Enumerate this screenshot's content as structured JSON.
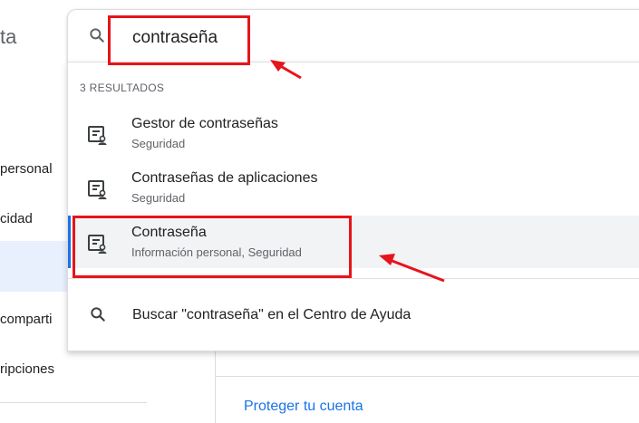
{
  "background": {
    "title_partial": "ta",
    "nav_items": [
      "personal",
      "cidad",
      "comparti",
      "ripciones"
    ],
    "protect_link": "Proteger tu cuenta"
  },
  "search": {
    "value": "contraseña",
    "icon": "search-icon"
  },
  "results": {
    "count_label": "3 RESULTADOS",
    "items": [
      {
        "title": "Gestor de contraseñas",
        "subtitle": "Seguridad",
        "icon": "settings-person-icon"
      },
      {
        "title": "Contraseñas de aplicaciones",
        "subtitle": "Seguridad",
        "icon": "settings-person-icon"
      },
      {
        "title": "Contraseña",
        "subtitle": "Información personal, Seguridad",
        "icon": "settings-person-icon"
      }
    ],
    "help_search": "Buscar \"contraseña\" en el Centro de Ayuda"
  },
  "colors": {
    "accent": "#1a73e8",
    "annotation": "#e6141b",
    "highlight_row": "#f1f3f4"
  }
}
